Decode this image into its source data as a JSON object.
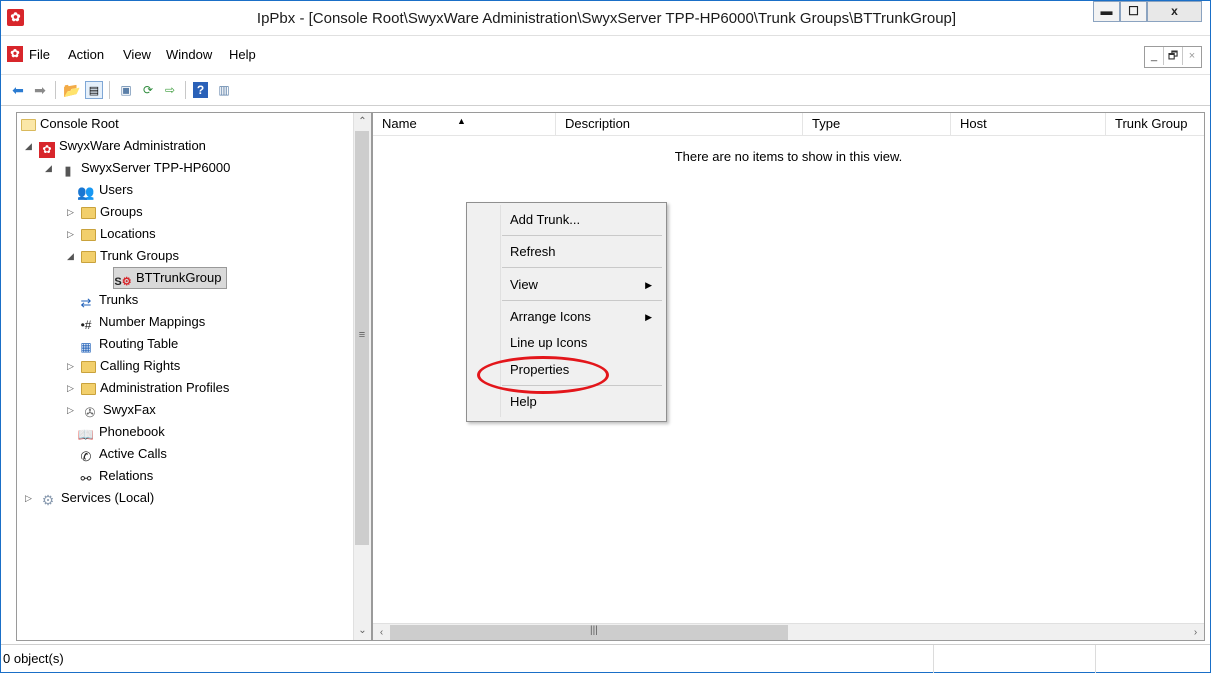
{
  "window": {
    "title": "IpPbx - [Console Root\\SwyxWare Administration\\SwyxServer TPP-HP6000\\Trunk Groups\\BTTrunkGroup]",
    "minimize_glyph": "▬",
    "maximize_glyph": "☐",
    "close_glyph": "x"
  },
  "menubar": {
    "items": [
      {
        "label": "File"
      },
      {
        "label": "Action"
      },
      {
        "label": "View"
      },
      {
        "label": "Window"
      },
      {
        "label": "Help"
      }
    ],
    "mdi": {
      "minimize": "_",
      "restore": "🗗",
      "close": "×"
    }
  },
  "toolbar": {
    "icons": [
      "back-icon",
      "forward-icon",
      "up-folder-icon",
      "show-hide-tree-icon",
      "properties-icon",
      "refresh-icon",
      "export-list-icon",
      "help-icon",
      "show-action-pane-icon"
    ]
  },
  "tree": {
    "items": [
      {
        "label": "Console Root"
      },
      {
        "label": "SwyxWare Administration"
      },
      {
        "label": "SwyxServer TPP-HP6000"
      },
      {
        "label": "Users"
      },
      {
        "label": "Groups"
      },
      {
        "label": "Locations"
      },
      {
        "label": "Trunk Groups"
      },
      {
        "label": "BTTrunkGroup"
      },
      {
        "label": "Trunks"
      },
      {
        "label": "Number Mappings"
      },
      {
        "label": "Routing Table"
      },
      {
        "label": "Calling Rights"
      },
      {
        "label": "Administration Profiles"
      },
      {
        "label": "SwyxFax"
      },
      {
        "label": "Phonebook"
      },
      {
        "label": "Active Calls"
      },
      {
        "label": "Relations"
      },
      {
        "label": "Services (Local)"
      }
    ]
  },
  "list": {
    "columns": [
      {
        "label": "Name"
      },
      {
        "label": "Description"
      },
      {
        "label": "Type"
      },
      {
        "label": "Host"
      },
      {
        "label": "Trunk Group"
      }
    ],
    "empty_message": "There are no items to show in this view."
  },
  "context_menu": {
    "items": [
      {
        "label": "Add Trunk..."
      },
      {
        "label": "Refresh"
      },
      {
        "label": "View"
      },
      {
        "label": "Arrange Icons"
      },
      {
        "label": "Line up Icons"
      },
      {
        "label": "Properties"
      },
      {
        "label": "Help"
      }
    ]
  },
  "statusbar": {
    "text": "0 object(s)"
  },
  "colors": {
    "accent": "#1a6fc7",
    "brand_red": "#d8262b",
    "highlight_oval": "#e3161b"
  }
}
